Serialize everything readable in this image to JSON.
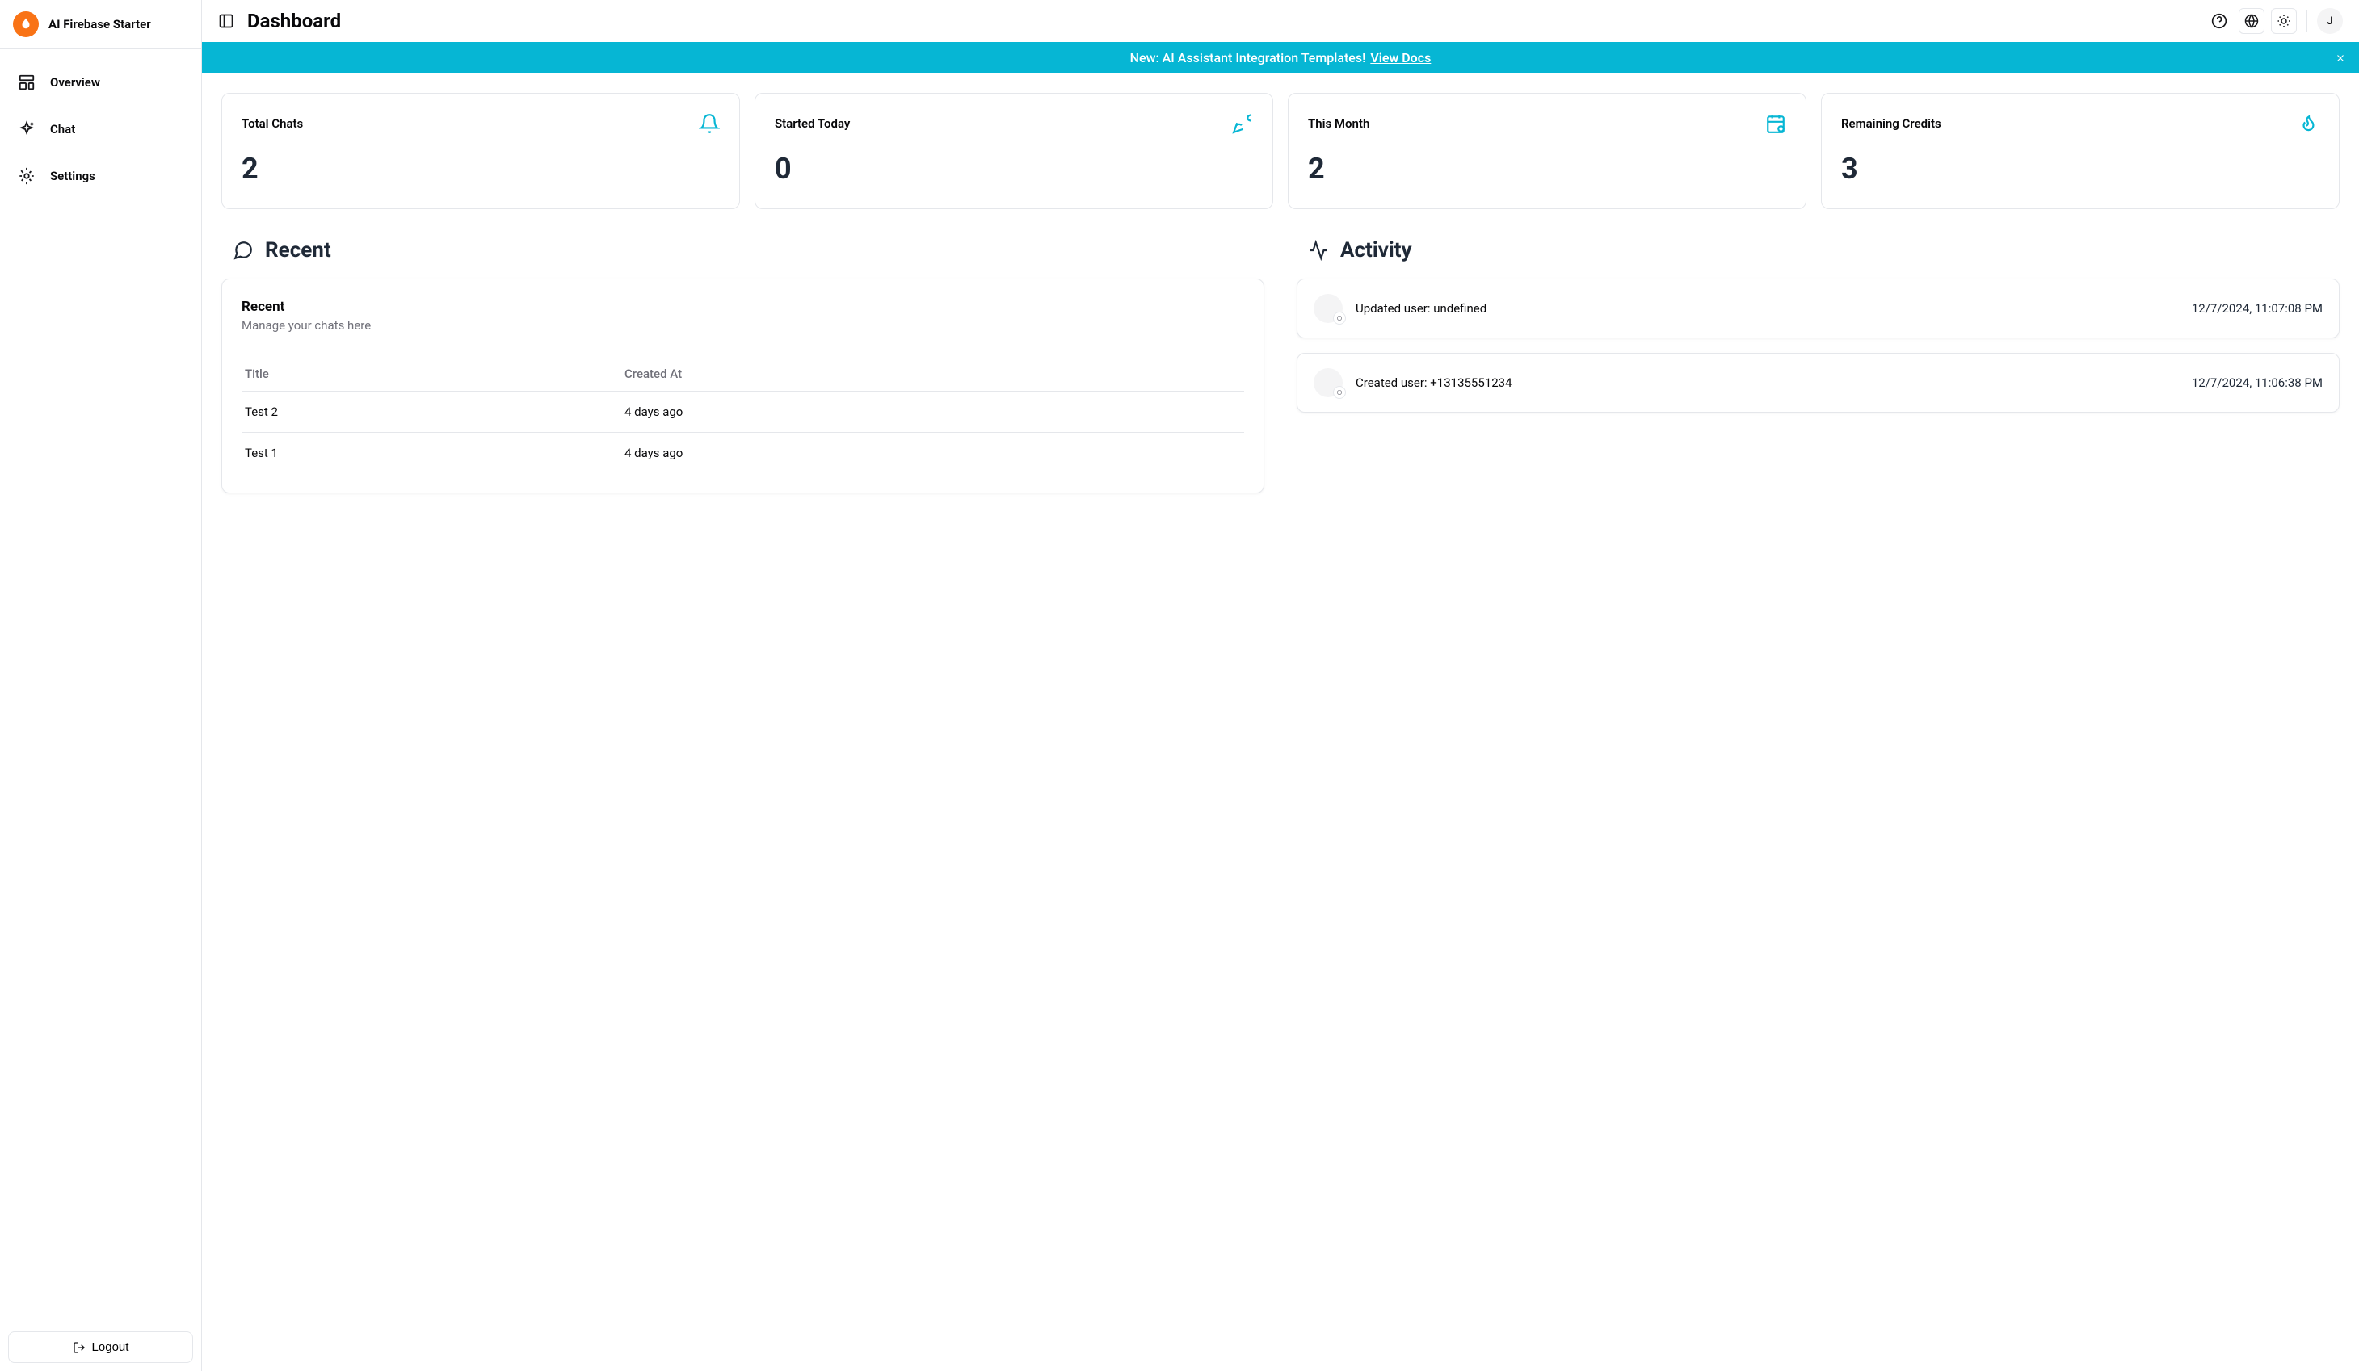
{
  "brand": "AI Firebase Starter",
  "nav": [
    {
      "label": "Overview"
    },
    {
      "label": "Chat"
    },
    {
      "label": "Settings"
    }
  ],
  "logout_label": "Logout",
  "page_title": "Dashboard",
  "avatar_initial": "J",
  "banner": {
    "text": "New: AI Assistant Integration Templates!",
    "link": "View Docs"
  },
  "stats": [
    {
      "label": "Total Chats",
      "value": "2"
    },
    {
      "label": "Started Today",
      "value": "0"
    },
    {
      "label": "This Month",
      "value": "2"
    },
    {
      "label": "Remaining Credits",
      "value": "3"
    }
  ],
  "recent": {
    "heading": "Recent",
    "card_title": "Recent",
    "card_subtitle": "Manage your chats here",
    "columns": {
      "title": "Title",
      "created": "Created At"
    },
    "rows": [
      {
        "title": "Test 2",
        "created": "4 days ago"
      },
      {
        "title": "Test 1",
        "created": "4 days ago"
      }
    ]
  },
  "activity": {
    "heading": "Activity",
    "items": [
      {
        "text": "Updated user: undefined",
        "time": "12/7/2024, 11:07:08 PM"
      },
      {
        "text": "Created user: +13135551234",
        "time": "12/7/2024, 11:06:38 PM"
      }
    ]
  }
}
